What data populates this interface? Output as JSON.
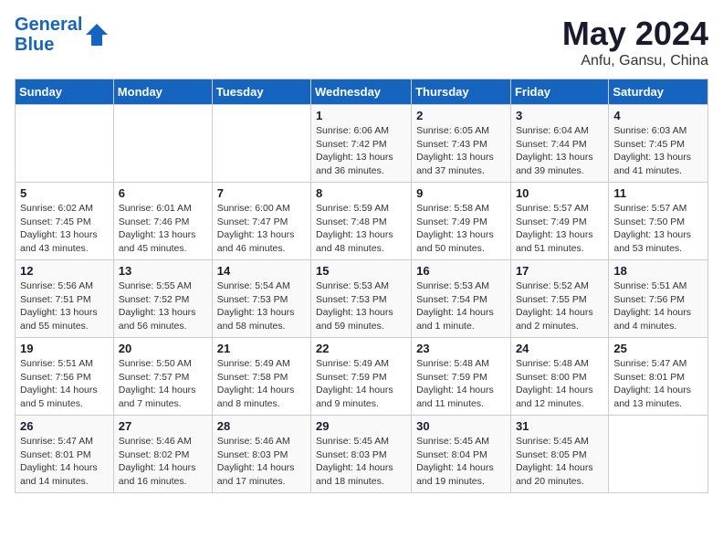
{
  "header": {
    "logo_line1": "General",
    "logo_line2": "Blue",
    "main_title": "May 2024",
    "subtitle": "Anfu, Gansu, China"
  },
  "weekdays": [
    "Sunday",
    "Monday",
    "Tuesday",
    "Wednesday",
    "Thursday",
    "Friday",
    "Saturday"
  ],
  "weeks": [
    [
      {
        "day": "",
        "info": ""
      },
      {
        "day": "",
        "info": ""
      },
      {
        "day": "",
        "info": ""
      },
      {
        "day": "1",
        "info": "Sunrise: 6:06 AM\nSunset: 7:42 PM\nDaylight: 13 hours\nand 36 minutes."
      },
      {
        "day": "2",
        "info": "Sunrise: 6:05 AM\nSunset: 7:43 PM\nDaylight: 13 hours\nand 37 minutes."
      },
      {
        "day": "3",
        "info": "Sunrise: 6:04 AM\nSunset: 7:44 PM\nDaylight: 13 hours\nand 39 minutes."
      },
      {
        "day": "4",
        "info": "Sunrise: 6:03 AM\nSunset: 7:45 PM\nDaylight: 13 hours\nand 41 minutes."
      }
    ],
    [
      {
        "day": "5",
        "info": "Sunrise: 6:02 AM\nSunset: 7:45 PM\nDaylight: 13 hours\nand 43 minutes."
      },
      {
        "day": "6",
        "info": "Sunrise: 6:01 AM\nSunset: 7:46 PM\nDaylight: 13 hours\nand 45 minutes."
      },
      {
        "day": "7",
        "info": "Sunrise: 6:00 AM\nSunset: 7:47 PM\nDaylight: 13 hours\nand 46 minutes."
      },
      {
        "day": "8",
        "info": "Sunrise: 5:59 AM\nSunset: 7:48 PM\nDaylight: 13 hours\nand 48 minutes."
      },
      {
        "day": "9",
        "info": "Sunrise: 5:58 AM\nSunset: 7:49 PM\nDaylight: 13 hours\nand 50 minutes."
      },
      {
        "day": "10",
        "info": "Sunrise: 5:57 AM\nSunset: 7:49 PM\nDaylight: 13 hours\nand 51 minutes."
      },
      {
        "day": "11",
        "info": "Sunrise: 5:57 AM\nSunset: 7:50 PM\nDaylight: 13 hours\nand 53 minutes."
      }
    ],
    [
      {
        "day": "12",
        "info": "Sunrise: 5:56 AM\nSunset: 7:51 PM\nDaylight: 13 hours\nand 55 minutes."
      },
      {
        "day": "13",
        "info": "Sunrise: 5:55 AM\nSunset: 7:52 PM\nDaylight: 13 hours\nand 56 minutes."
      },
      {
        "day": "14",
        "info": "Sunrise: 5:54 AM\nSunset: 7:53 PM\nDaylight: 13 hours\nand 58 minutes."
      },
      {
        "day": "15",
        "info": "Sunrise: 5:53 AM\nSunset: 7:53 PM\nDaylight: 13 hours\nand 59 minutes."
      },
      {
        "day": "16",
        "info": "Sunrise: 5:53 AM\nSunset: 7:54 PM\nDaylight: 14 hours\nand 1 minute."
      },
      {
        "day": "17",
        "info": "Sunrise: 5:52 AM\nSunset: 7:55 PM\nDaylight: 14 hours\nand 2 minutes."
      },
      {
        "day": "18",
        "info": "Sunrise: 5:51 AM\nSunset: 7:56 PM\nDaylight: 14 hours\nand 4 minutes."
      }
    ],
    [
      {
        "day": "19",
        "info": "Sunrise: 5:51 AM\nSunset: 7:56 PM\nDaylight: 14 hours\nand 5 minutes."
      },
      {
        "day": "20",
        "info": "Sunrise: 5:50 AM\nSunset: 7:57 PM\nDaylight: 14 hours\nand 7 minutes."
      },
      {
        "day": "21",
        "info": "Sunrise: 5:49 AM\nSunset: 7:58 PM\nDaylight: 14 hours\nand 8 minutes."
      },
      {
        "day": "22",
        "info": "Sunrise: 5:49 AM\nSunset: 7:59 PM\nDaylight: 14 hours\nand 9 minutes."
      },
      {
        "day": "23",
        "info": "Sunrise: 5:48 AM\nSunset: 7:59 PM\nDaylight: 14 hours\nand 11 minutes."
      },
      {
        "day": "24",
        "info": "Sunrise: 5:48 AM\nSunset: 8:00 PM\nDaylight: 14 hours\nand 12 minutes."
      },
      {
        "day": "25",
        "info": "Sunrise: 5:47 AM\nSunset: 8:01 PM\nDaylight: 14 hours\nand 13 minutes."
      }
    ],
    [
      {
        "day": "26",
        "info": "Sunrise: 5:47 AM\nSunset: 8:01 PM\nDaylight: 14 hours\nand 14 minutes."
      },
      {
        "day": "27",
        "info": "Sunrise: 5:46 AM\nSunset: 8:02 PM\nDaylight: 14 hours\nand 16 minutes."
      },
      {
        "day": "28",
        "info": "Sunrise: 5:46 AM\nSunset: 8:03 PM\nDaylight: 14 hours\nand 17 minutes."
      },
      {
        "day": "29",
        "info": "Sunrise: 5:45 AM\nSunset: 8:03 PM\nDaylight: 14 hours\nand 18 minutes."
      },
      {
        "day": "30",
        "info": "Sunrise: 5:45 AM\nSunset: 8:04 PM\nDaylight: 14 hours\nand 19 minutes."
      },
      {
        "day": "31",
        "info": "Sunrise: 5:45 AM\nSunset: 8:05 PM\nDaylight: 14 hours\nand 20 minutes."
      },
      {
        "day": "",
        "info": ""
      }
    ]
  ]
}
